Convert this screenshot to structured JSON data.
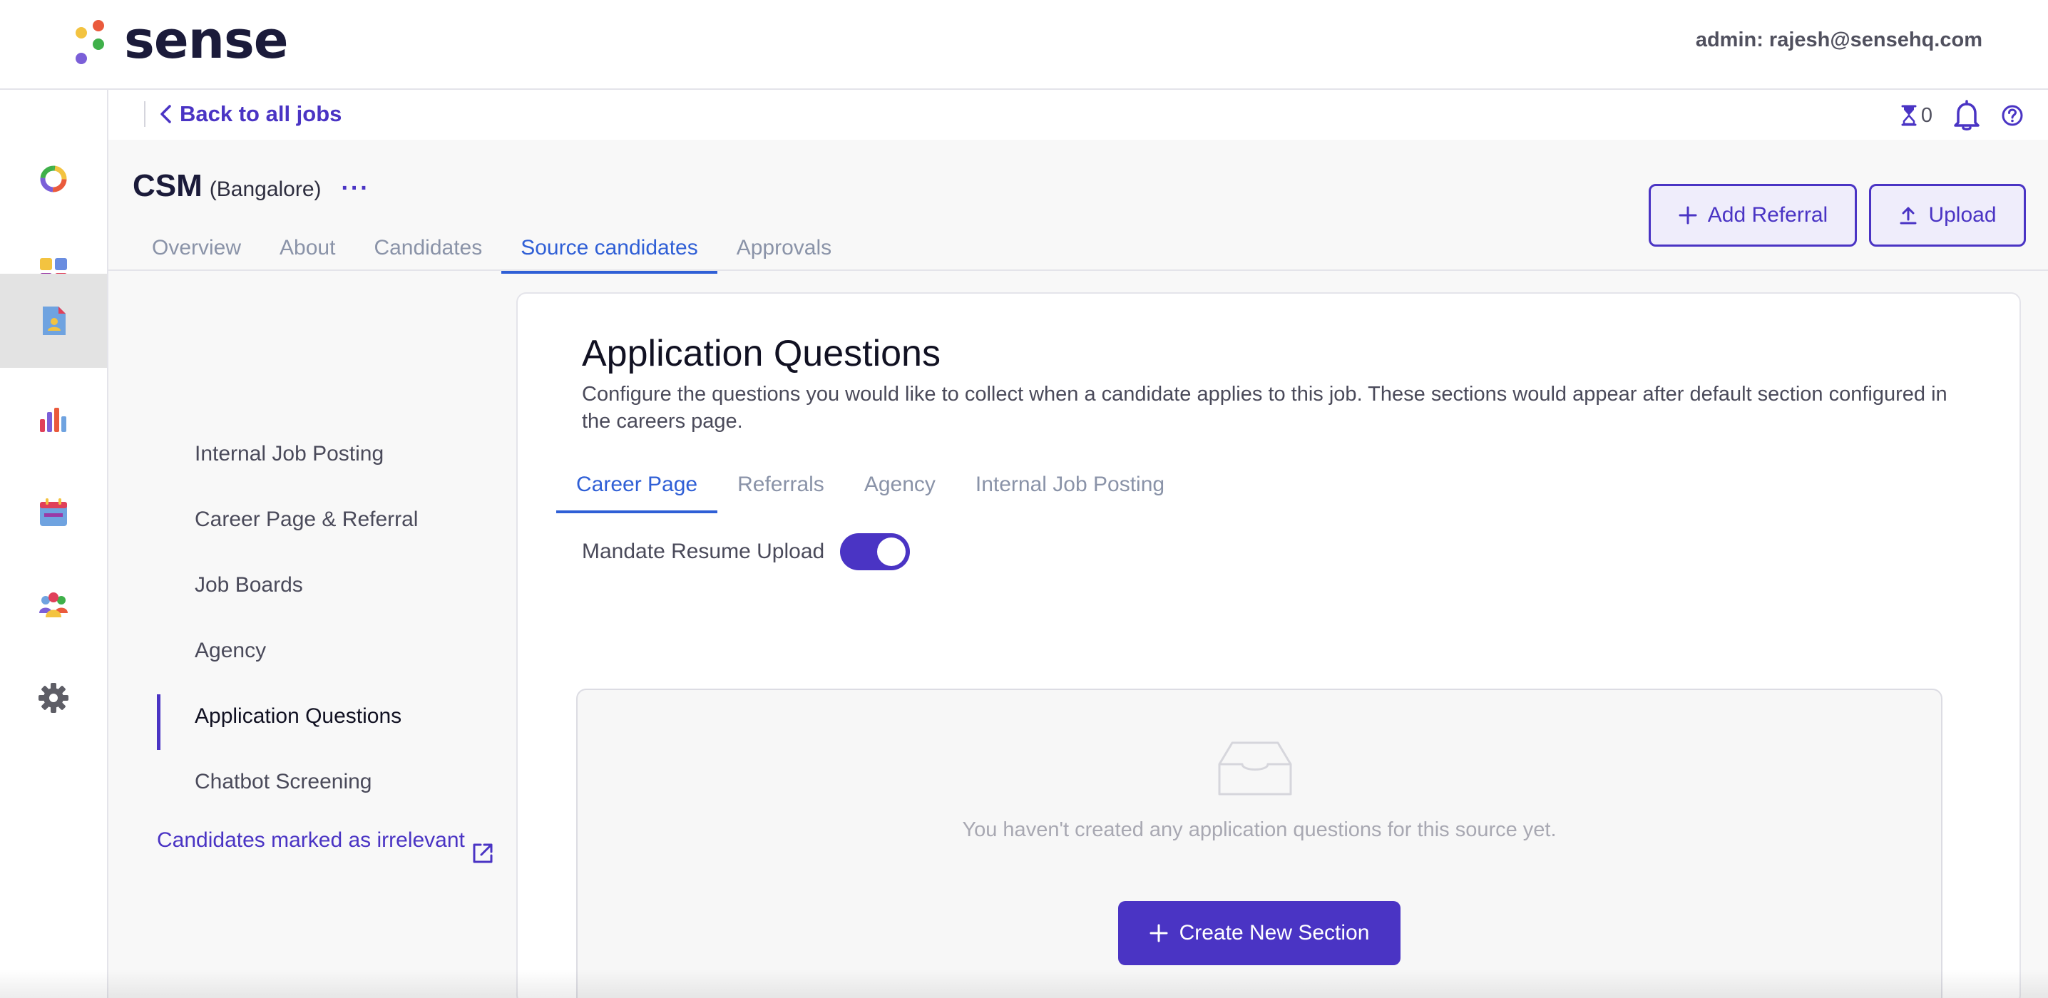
{
  "brand": {
    "name": "sense",
    "dot_colors": [
      "#f3c340",
      "#ea5a3c",
      "#3fb04a",
      "#7b5fd8"
    ]
  },
  "header": {
    "admin_text": "admin: rajesh@sensehq.com"
  },
  "rail": {
    "items": [
      {
        "icon": "donut-icon"
      },
      {
        "icon": "grid-icon"
      },
      {
        "icon": "job-document-icon",
        "active": true
      },
      {
        "icon": "bar-chart-icon"
      },
      {
        "icon": "calendar-icon"
      },
      {
        "icon": "people-icon"
      },
      {
        "icon": "gear-icon"
      }
    ]
  },
  "subbar": {
    "back_label": "Back to all jobs",
    "pending_count": "0"
  },
  "job": {
    "name": "CSM",
    "location": "(Bangalore)",
    "more": "···"
  },
  "tabs": [
    {
      "label": "Overview"
    },
    {
      "label": "About"
    },
    {
      "label": "Candidates"
    },
    {
      "label": "Source candidates",
      "active": true
    },
    {
      "label": "Approvals"
    }
  ],
  "actions": {
    "add_referral": "Add Referral",
    "upload": "Upload"
  },
  "subnav": {
    "items": [
      {
        "label": "Internal Job Posting"
      },
      {
        "label": "Career Page & Referral"
      },
      {
        "label": "Job Boards"
      },
      {
        "label": "Agency"
      },
      {
        "label": "Application Questions",
        "active": true
      },
      {
        "label": "Chatbot Screening"
      }
    ],
    "irrelevant_link": "Candidates marked as irrelevant"
  },
  "card": {
    "title": "Application Questions",
    "description": "Configure the questions you would like to collect when a candidate applies to this job. These sections would appear after default section configured in the careers page.",
    "tabs": [
      {
        "label": "Career Page",
        "active": true
      },
      {
        "label": "Referrals"
      },
      {
        "label": "Agency"
      },
      {
        "label": "Internal Job Posting"
      }
    ],
    "mandate_label": "Mandate Resume Upload",
    "mandate_enabled": true,
    "empty_text": "You haven't created any application questions for this source yet.",
    "create_button": "Create New Section"
  },
  "colors": {
    "accent": "#4a34c4",
    "tab_active": "#2f5fd6",
    "tab_inactive": "#8a93a8"
  }
}
